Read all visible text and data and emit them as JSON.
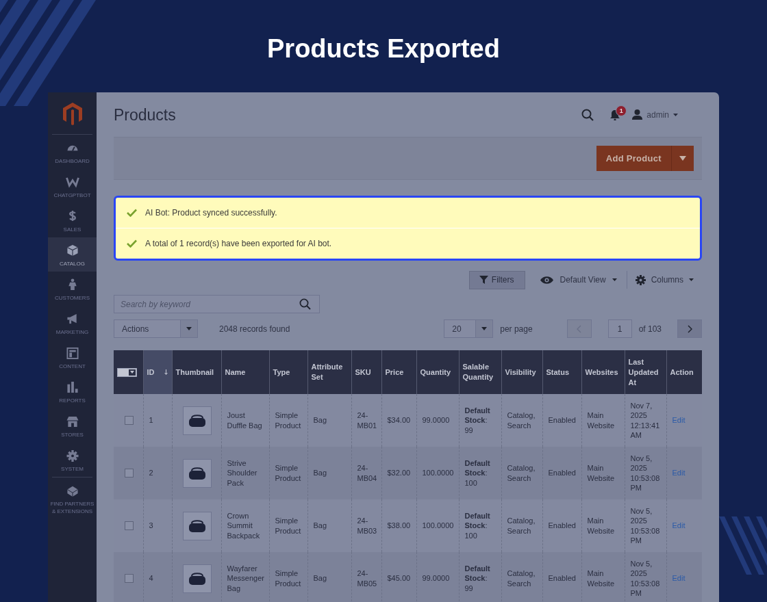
{
  "title": "Products Exported",
  "sidebar": {
    "items": [
      {
        "label": "DASHBOARD",
        "selected": false
      },
      {
        "label": "CHATGPTBOT",
        "selected": false
      },
      {
        "label": "SALES",
        "selected": false
      },
      {
        "label": "CATALOG",
        "selected": true
      },
      {
        "label": "CUSTOMERS",
        "selected": false
      },
      {
        "label": "MARKETING",
        "selected": false
      },
      {
        "label": "CONTENT",
        "selected": false
      },
      {
        "label": "REPORTS",
        "selected": false
      },
      {
        "label": "STORES",
        "selected": false
      },
      {
        "label": "SYSTEM",
        "selected": false
      },
      {
        "label": "FIND PARTNERS & EXTENSIONS",
        "selected": false
      }
    ]
  },
  "header": {
    "title": "Products",
    "notifications": "1",
    "user": "admin"
  },
  "add_button": "Add Product",
  "messages": [
    "AI Bot: Product synced successfully.",
    "A total of 1 record(s) have been exported for AI bot."
  ],
  "toolbar": {
    "filters": "Filters",
    "view": "Default View",
    "columns": "Columns"
  },
  "search": {
    "placeholder": "Search by keyword"
  },
  "actions": "Actions",
  "records": "2048 records found",
  "per_page": {
    "value": "20",
    "label": "per page"
  },
  "page": {
    "value": "1",
    "total": "of 103"
  },
  "table": {
    "columns": [
      {
        "label": "ID",
        "sorted": true
      },
      {
        "label": "Thumbnail",
        "sorted": false
      },
      {
        "label": "Name",
        "sorted": false
      },
      {
        "label": "Type",
        "sorted": false
      },
      {
        "label": "Attribute Set",
        "sorted": false
      },
      {
        "label": "SKU",
        "sorted": false
      },
      {
        "label": "Price",
        "sorted": false
      },
      {
        "label": "Quantity",
        "sorted": false
      },
      {
        "label": "Salable Quantity",
        "sorted": false
      },
      {
        "label": "Visibility",
        "sorted": false
      },
      {
        "label": "Status",
        "sorted": false
      },
      {
        "label": "Websites",
        "sorted": false
      },
      {
        "label": "Last Updated At",
        "sorted": false
      },
      {
        "label": "Action",
        "sorted": false
      }
    ],
    "rows": [
      {
        "checked": false,
        "id": "1",
        "name": "Joust Duffle Bag",
        "type": "Simple Product",
        "attribute_set": "Bag",
        "sku": "24-MB01",
        "price": "$34.00",
        "quantity": "99.0000",
        "salable_quantity": "**Default Stock**: 99",
        "visibility": "Catalog, Search",
        "status": "Enabled",
        "websites": "Main Website",
        "last_updated": "Nov 7, 2025 12:13:41 AM",
        "action": "Edit"
      },
      {
        "checked": false,
        "id": "2",
        "name": "Strive Shoulder Pack",
        "type": "Simple Product",
        "attribute_set": "Bag",
        "sku": "24-MB04",
        "price": "$32.00",
        "quantity": "100.0000",
        "salable_quantity": "**Default Stock**: 100",
        "visibility": "Catalog, Search",
        "status": "Enabled",
        "websites": "Main Website",
        "last_updated": "Nov 5, 2025 10:53:08 PM",
        "action": "Edit"
      },
      {
        "checked": false,
        "id": "3",
        "name": "Crown Summit Backpack",
        "type": "Simple Product",
        "attribute_set": "Bag",
        "sku": "24-MB03",
        "price": "$38.00",
        "quantity": "100.0000",
        "salable_quantity": "**Default Stock**: 100",
        "visibility": "Catalog, Search",
        "status": "Enabled",
        "websites": "Main Website",
        "last_updated": "Nov 5, 2025 10:53:08 PM",
        "action": "Edit"
      },
      {
        "checked": false,
        "id": "4",
        "name": "Wayfarer Messenger Bag",
        "type": "Simple Product",
        "attribute_set": "Bag",
        "sku": "24-MB05",
        "price": "$45.00",
        "quantity": "99.0000",
        "salable_quantity": "**Default Stock**: 99",
        "visibility": "Catalog, Search",
        "status": "Enabled",
        "websites": "Main Website",
        "last_updated": "Nov 5, 2025 10:53:08 PM",
        "action": "Edit"
      }
    ]
  }
}
